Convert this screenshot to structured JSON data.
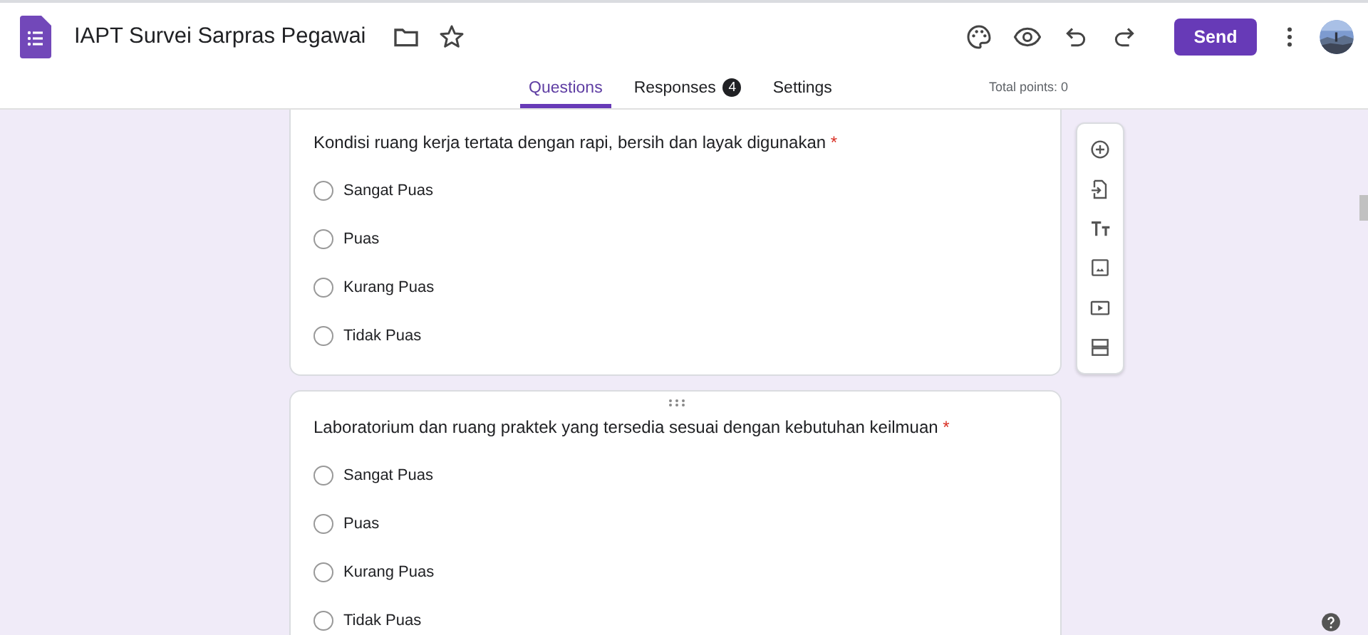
{
  "form": {
    "title": "IAPT Survei Sarpras Pegawai"
  },
  "send_button": {
    "label": "Send"
  },
  "tabs": [
    {
      "label": "Questions",
      "selected": true
    },
    {
      "label": "Responses",
      "selected": false,
      "badge": "4"
    },
    {
      "label": "Settings",
      "selected": false
    }
  ],
  "total_points": "Total points: 0",
  "questions": [
    {
      "text": "Kondisi ruang kerja tertata dengan rapi, bersih dan layak digunakan",
      "required_mark": "*",
      "drag_handle": false,
      "options": [
        {
          "label": "Sangat Puas",
          "selected": false
        },
        {
          "label": "Puas",
          "selected": false
        },
        {
          "label": "Kurang Puas",
          "selected": false
        },
        {
          "label": "Tidak Puas",
          "selected": false
        }
      ]
    },
    {
      "text": "Laboratorium dan ruang praktek yang tersedia sesuai dengan kebutuhan keilmuan",
      "required_mark": "*",
      "drag_handle": true,
      "options": [
        {
          "label": "Sangat Puas",
          "selected": false
        },
        {
          "label": "Puas",
          "selected": false
        },
        {
          "label": "Kurang Puas",
          "selected": false
        },
        {
          "label": "Tidak Puas",
          "selected": false
        }
      ]
    }
  ]
}
